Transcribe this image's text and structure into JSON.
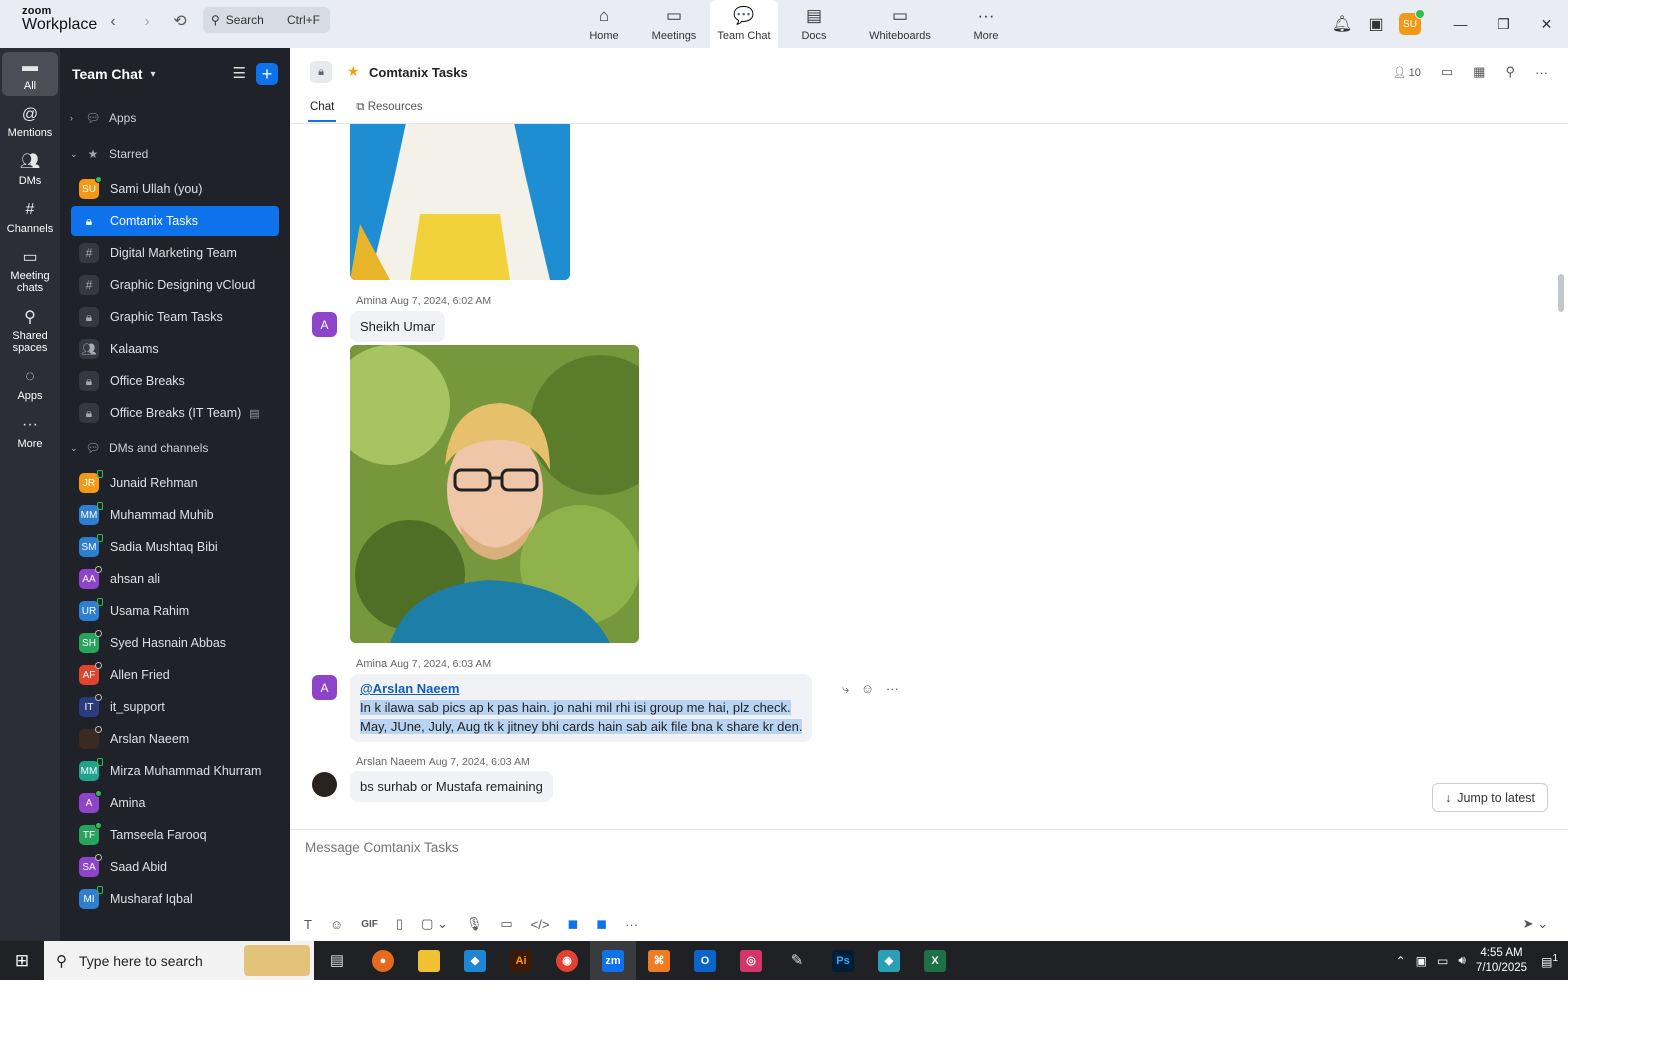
{
  "logo": {
    "line1": "zoom",
    "line2": "Workplace"
  },
  "search": {
    "label": "Search",
    "shortcut": "Ctrl+F"
  },
  "top_tabs": [
    {
      "label": "Home",
      "icon": "home-icon"
    },
    {
      "label": "Meetings",
      "icon": "video-icon"
    },
    {
      "label": "Team Chat",
      "icon": "chat-icon"
    },
    {
      "label": "Docs",
      "icon": "doc-icon"
    },
    {
      "label": "Whiteboards",
      "icon": "whiteboard-icon"
    },
    {
      "label": "More",
      "icon": "more-icon"
    }
  ],
  "user_avatar": "SU",
  "rail": [
    {
      "label": "All"
    },
    {
      "label": "Mentions"
    },
    {
      "label": "DMs"
    },
    {
      "label": "Channels"
    },
    {
      "label": "Meeting chats"
    },
    {
      "label": "Shared spaces"
    },
    {
      "label": "Apps"
    },
    {
      "label": "More"
    }
  ],
  "sidebar": {
    "title": "Team Chat",
    "sections": {
      "apps": "Apps",
      "starred": "Starred",
      "dms": "DMs and channels"
    },
    "starred": [
      {
        "label": "Sami Ullah (you)",
        "initials": "SU",
        "color": "#f29a18",
        "status": "online"
      },
      {
        "label": "Comtanix Tasks",
        "glyph": "lock-icon"
      },
      {
        "label": "Digital Marketing Team",
        "glyph": "hash-icon"
      },
      {
        "label": "Graphic Designing vCloud",
        "glyph": "hash-icon"
      },
      {
        "label": "Graphic Team Tasks",
        "glyph": "lock-icon"
      },
      {
        "label": "Kalaams",
        "glyph": "group-icon"
      },
      {
        "label": "Office Breaks",
        "glyph": "lock-icon"
      },
      {
        "label": "Office Breaks (IT Team)",
        "glyph": "lock-icon"
      }
    ],
    "dms": [
      {
        "label": "Junaid Rehman",
        "initials": "JR",
        "color": "#f29a18",
        "status": "mobile"
      },
      {
        "label": "Muhammad Muhib",
        "initials": "MM",
        "color": "#2f7fd1",
        "status": "mobile"
      },
      {
        "label": "Sadia Mushtaq Bibi",
        "initials": "SM",
        "color": "#2f7fd1",
        "status": "mobile"
      },
      {
        "label": "ahsan ali",
        "initials": "AA",
        "color": "#8e44c8",
        "status": "offline"
      },
      {
        "label": "Usama Rahim",
        "initials": "UR",
        "color": "#2f7fd1",
        "status": "mobile"
      },
      {
        "label": "Syed Hasnain Abbas",
        "initials": "SH",
        "color": "#27a35b",
        "status": "offline"
      },
      {
        "label": "Allen Fried",
        "initials": "AF",
        "color": "#e0452f",
        "status": "offline"
      },
      {
        "label": "it_support",
        "initials": "IT",
        "color": "#2b3b80",
        "status": "offline"
      },
      {
        "label": "Arslan Naeem",
        "initials": "",
        "color": "#3a2a22",
        "status": "offline"
      },
      {
        "label": "Mirza Muhammad Khurram",
        "initials": "MM",
        "color": "#1fa38f",
        "status": "mobile"
      },
      {
        "label": "Amina",
        "initials": "A",
        "color": "#8e44c8",
        "status": "online"
      },
      {
        "label": "Tamseela Farooq",
        "initials": "TF",
        "color": "#27a35b",
        "status": "online"
      },
      {
        "label": "Saad Abid",
        "initials": "SA",
        "color": "#8e44c8",
        "status": "offline"
      },
      {
        "label": "Musharaf Iqbal",
        "initials": "MI",
        "color": "#2f7fd1",
        "status": "mobile"
      }
    ]
  },
  "chat": {
    "title": "Comtanix Tasks",
    "member_count": "10",
    "subtabs": [
      "Chat",
      "Resources"
    ],
    "messages": [
      {
        "sender": "Amina",
        "time": "Aug 7, 2024, 6:02 AM",
        "avatar": "A",
        "text": "Sheikh Umar"
      },
      {
        "sender": "Amina",
        "time": "Aug 7, 2024, 6:03 AM",
        "avatar": "A",
        "mention": "@Arslan Naeem",
        "line1": "In k ilawa sab pics ap k pas hain. jo nahi mil rhi isi group me hai, plz check.",
        "line2": "May, JUne, July, Aug tk k jitney bhi cards hain sab aik file bna k share kr den."
      },
      {
        "sender": "Arslan Naeem",
        "time": "Aug 7, 2024, 6:03 AM",
        "text": "bs surhab or Mustafa remaining"
      }
    ],
    "jump_label": "Jump to latest",
    "composer_placeholder": "Message Comtanix Tasks"
  },
  "taskbar": {
    "search_placeholder": "Type here to search",
    "time": "4:55 AM",
    "date": "7/10/2025",
    "notif_count": "1"
  }
}
